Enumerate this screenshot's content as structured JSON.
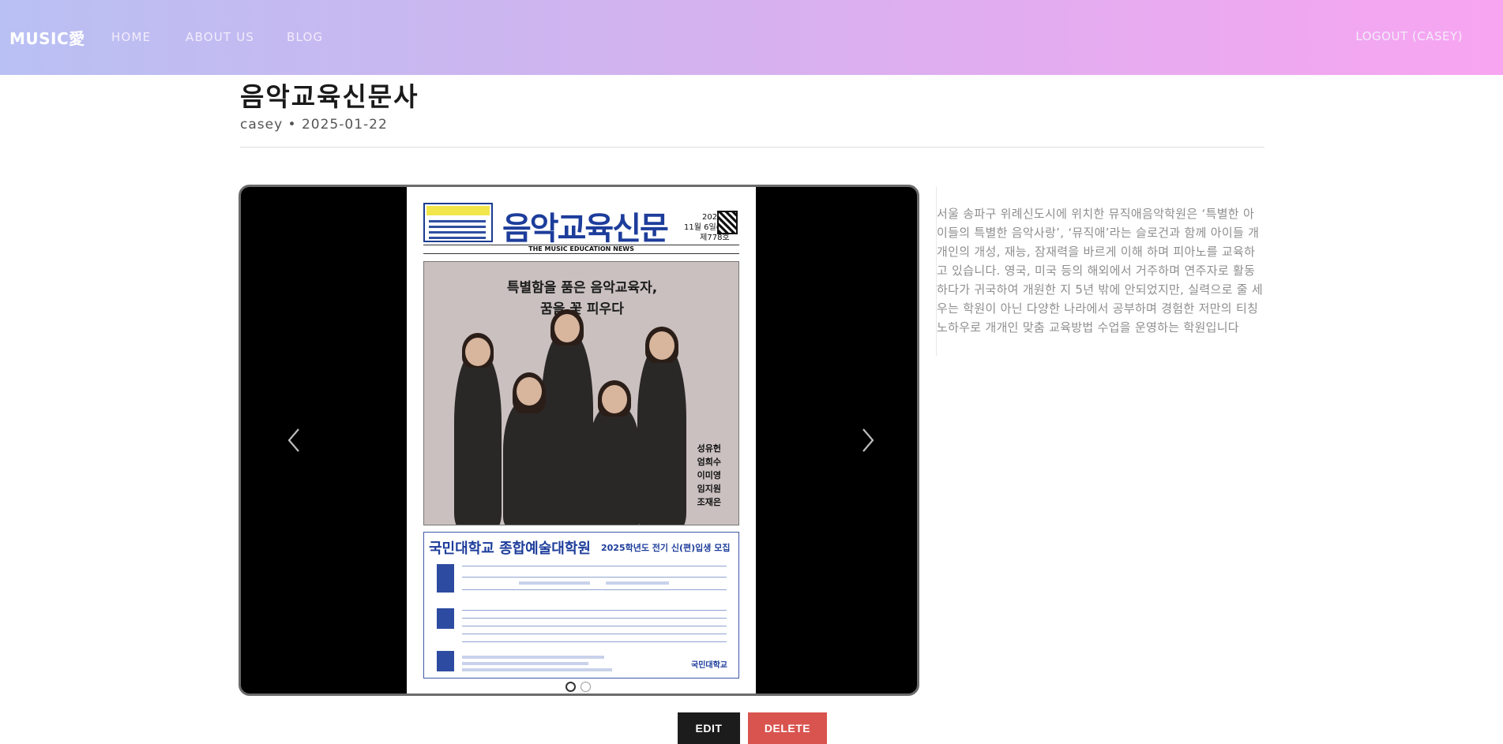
{
  "nav": {
    "brand": "MUSIC愛",
    "home": "HOME",
    "about": "ABOUT US",
    "blog": "BLOG",
    "logout": "LOGOUT (CASEY)"
  },
  "post": {
    "title": "음악교육신문사",
    "meta": "casey • 2025-01-22",
    "body": "서울 송파구 위례신도시에 위치한 뮤직애음악학원은 ‘특별한 아이들의 특별한 음악사랑’, ‘뮤직애’라는 슬로건과 함께 아이들 개개인의 개성, 재능, 잠재력을 바르게 이해 하며 피아노를 교육하고 있습니다. 영국, 미국 등의 해외에서 거주하며 연주자로 활동하다가 귀국하여 개원한 지 5년 밖에 안되었지만, 실력으로 줄 세우는 학원이 아닌 다양한 나라에서 공부하며 경험한 저만의 티칭 노하우로 개개인 맞춤 교육방법 수업을 운영하는 학원입니다"
  },
  "carousel": {
    "total_slides": 2,
    "active_slide": 1,
    "slide": {
      "newspaper_name": "음악교육신문",
      "newspaper_sub": "THE MUSIC EDUCATION NEWS",
      "date_line_1": "2024년",
      "date_line_2": "11월 6일(수)",
      "date_line_3": "제778호",
      "headline_1": "특별함을 품은 음악교육자,",
      "headline_2": "꿈을 꽃 피우다",
      "names": [
        "성유헌",
        "엄희수",
        "이미영",
        "임지원",
        "조재은"
      ],
      "ad_title": "국민대학교 종합예술대학원",
      "ad_sub": "2025학년도 전기 신(편)입생 모집",
      "ad_logo": "국민대학교"
    }
  },
  "actions": {
    "edit": "EDIT",
    "delete": "DELETE"
  },
  "colors": {
    "nav_gradient_start": "#b9c0f3",
    "nav_gradient_end": "#f8a5f1",
    "delete_red": "#d9534f",
    "edit_dark": "#1c1c1c"
  }
}
